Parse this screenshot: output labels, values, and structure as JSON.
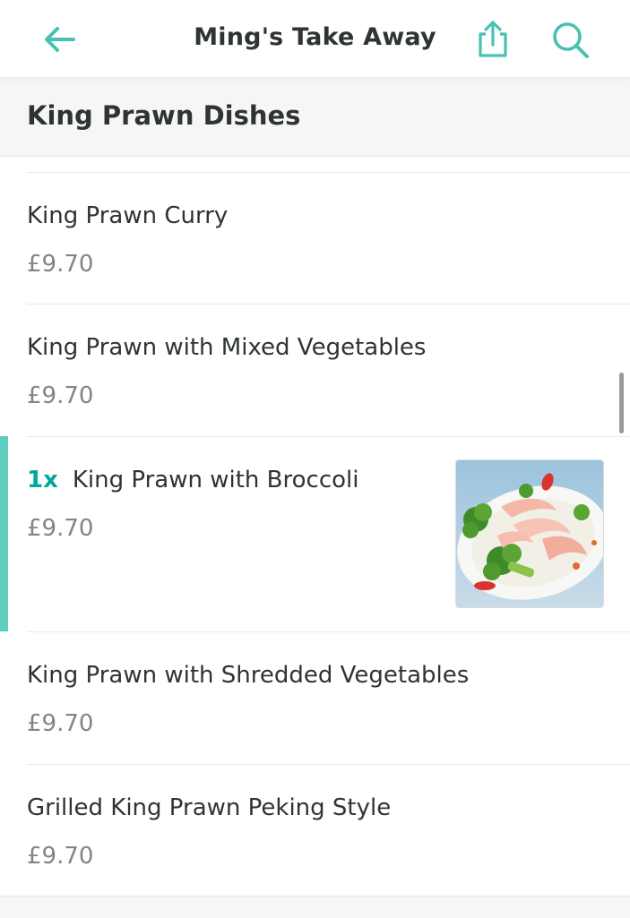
{
  "header": {
    "title": "Ming's Take Away",
    "back_icon": "arrow-left-icon",
    "share_icon": "share-icon",
    "search_icon": "search-icon",
    "accent_color": "#5fcdbd"
  },
  "section": {
    "title": "King Prawn Dishes"
  },
  "items": [
    {
      "name": "King Prawn Curry",
      "price": "£9.70",
      "quantity": ""
    },
    {
      "name": "King Prawn with Mixed Vegetables",
      "price": "£9.70",
      "quantity": ""
    },
    {
      "name": "King Prawn with Broccoli",
      "price": "£9.70",
      "quantity": "1x",
      "image": "king-prawn-broccoli-photo"
    },
    {
      "name": "King Prawn with Shredded Vegetables",
      "price": "£9.70",
      "quantity": ""
    },
    {
      "name": "Grilled King Prawn Peking Style",
      "price": "£9.70",
      "quantity": ""
    }
  ]
}
